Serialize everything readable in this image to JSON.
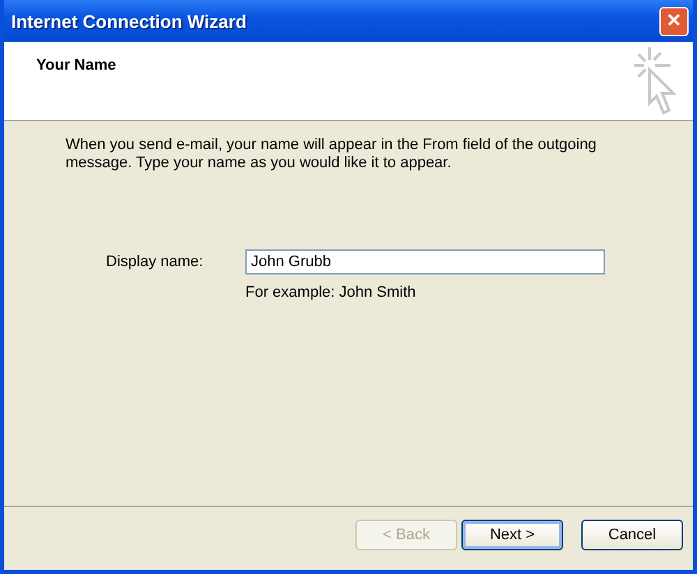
{
  "window": {
    "title": "Internet Connection Wizard",
    "close": "✕"
  },
  "header": {
    "title": "Your Name"
  },
  "intro": "When you send e-mail, your name will appear in the From field of the outgoing message. Type your name as you would like it to appear.",
  "field": {
    "label": "Display name:",
    "value": "John Grubb",
    "hint": "For example: John Smith"
  },
  "buttons": [
    {
      "label": "< Back",
      "disabled": true,
      "default": false
    },
    {
      "label": "Next >",
      "disabled": false,
      "default": true
    },
    {
      "label": "Cancel",
      "disabled": false,
      "default": false
    }
  ]
}
